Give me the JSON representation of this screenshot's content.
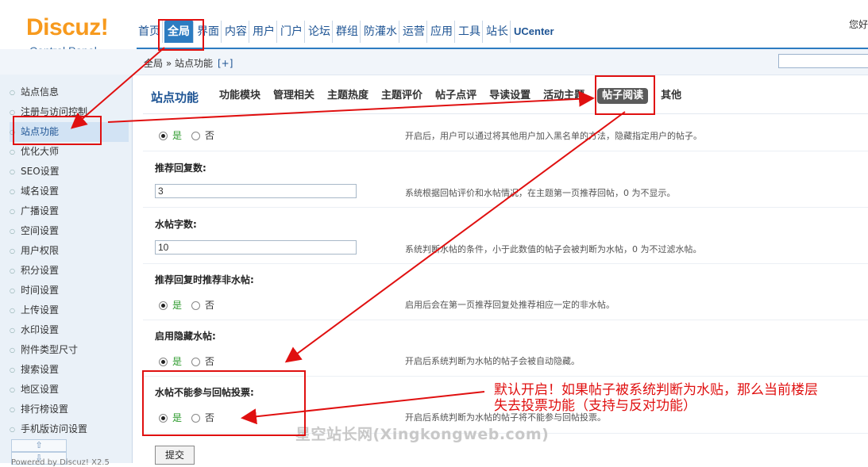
{
  "brand": {
    "name": "Discuz!",
    "subtitle": "Control Panel"
  },
  "nav": {
    "items": [
      "首页",
      "全局",
      "界面",
      "内容",
      "用户",
      "门户",
      "论坛",
      "群组",
      "防灌水",
      "运营",
      "应用",
      "工具",
      "站长",
      "UCenter"
    ],
    "user_hint": "您好"
  },
  "breadcrumb": {
    "path": "全局 » 站点功能",
    "add": "[+]"
  },
  "sidebar": {
    "items": [
      "站点信息",
      "注册与访问控制",
      "站点功能",
      "优化大师",
      "SEO设置",
      "域名设置",
      "广播设置",
      "空间设置",
      "用户权限",
      "积分设置",
      "时间设置",
      "上传设置",
      "水印设置",
      "附件类型尺寸",
      "搜索设置",
      "地区设置",
      "排行榜设置",
      "手机版访问设置"
    ],
    "pager_up": "⇧",
    "pager_down": "⇩",
    "footer": "Powered by Discuz! X2.5"
  },
  "main": {
    "title": "站点功能",
    "tabs": [
      "功能模块",
      "管理相关",
      "主题热度",
      "主题评价",
      "帖子点评",
      "导读设置",
      "活动主题",
      "帖子阅读",
      "其他"
    ],
    "rows": {
      "r0": {
        "yes": "是",
        "no": "否",
        "hint": "开启后，用户可以通过将其他用户加入黑名单的方法，隐藏指定用户的帖子。"
      },
      "r1": {
        "title": "推荐回复数:",
        "value": "3",
        "hint": "系统根据回帖评价和水帖情况，在主题第一页推荐回帖，0 为不显示。"
      },
      "r2": {
        "title": "水帖字数:",
        "value": "10",
        "hint": "系统判断水帖的条件，小于此数值的帖子会被判断为水帖，0 为不过滤水帖。"
      },
      "r3": {
        "title": "推荐回复时推荐非水帖:",
        "yes": "是",
        "no": "否",
        "hint": "启用后会在第一页推荐回复处推荐相应一定的非水帖。"
      },
      "r4": {
        "title": "启用隐藏水帖:",
        "yes": "是",
        "no": "否",
        "hint": "开启后系统判断为水帖的帖子会被自动隐藏。"
      },
      "r5": {
        "title": "水帖不能参与回帖投票:",
        "yes": "是",
        "no": "否",
        "hint": "开启后系统判断为水帖的帖子将不能参与回帖投票。"
      }
    },
    "submit": "提交"
  },
  "annotation": {
    "line1": "默认开启！如果帖子被系统判断为水贴，那么当前楼层",
    "line2": "失去投票功能（支持与反对功能）",
    "color": "#e01010"
  },
  "watermark": "星空站长网(Xingkongweb.com)",
  "colors": {
    "accent": "#2d7cc1",
    "logo": "#f79a1e",
    "annotation": "#e01010"
  }
}
